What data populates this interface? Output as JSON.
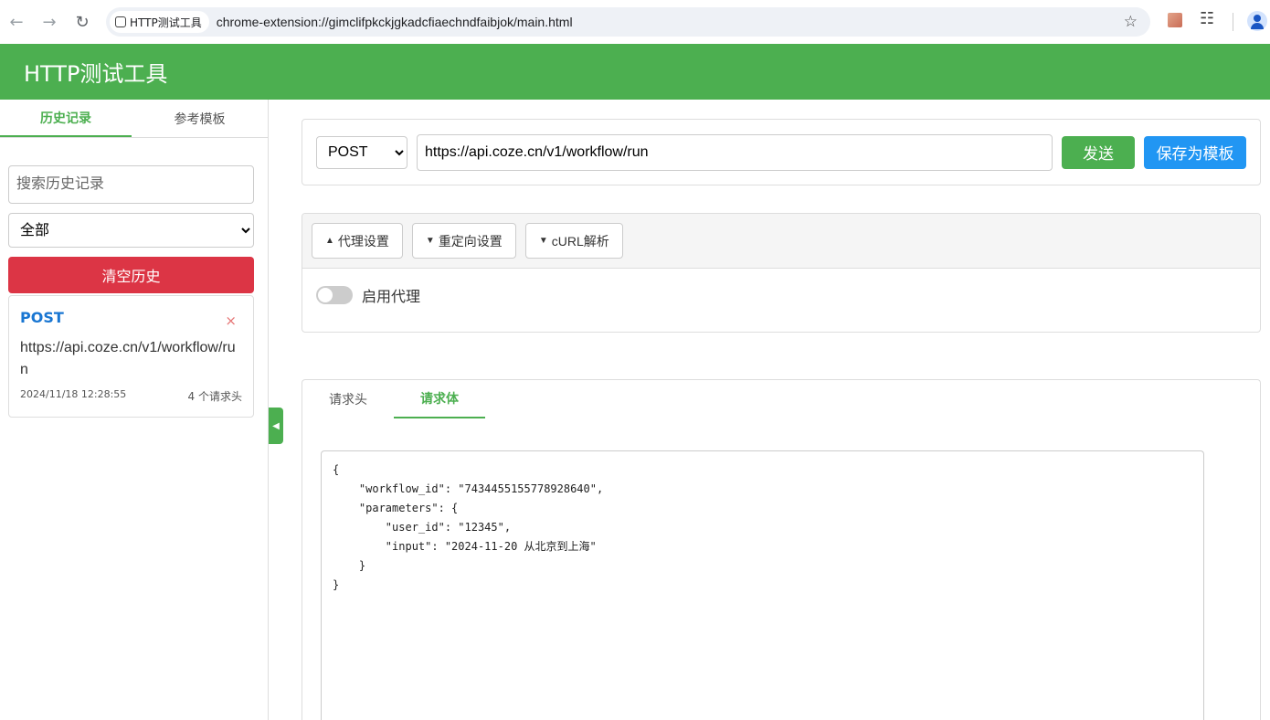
{
  "browser": {
    "tab_chip_label": "HTTP测试工具",
    "url": "chrome-extension://gimclifpkckjgkadcfiaechndfaibjok/main.html"
  },
  "app": {
    "title": "HTTP测试工具"
  },
  "sidebar": {
    "tabs": [
      {
        "label": "历史记录",
        "active": true
      },
      {
        "label": "参考模板",
        "active": false
      }
    ],
    "search_placeholder": "搜索历史记录",
    "filter_selected": "全部",
    "clear_button": "清空历史",
    "history": [
      {
        "method": "POST",
        "url": "https://api.coze.cn/v1/workflow/run",
        "time": "2024/11/18 12:28:55",
        "count": "4 个请求头",
        "close": "×"
      }
    ],
    "collapse_icon": "◀"
  },
  "request": {
    "method": "POST",
    "url": "https://api.coze.cn/v1/workflow/run",
    "send_label": "发送",
    "save_label": "保存为模板"
  },
  "settings": {
    "buttons": [
      {
        "arrow": "▲",
        "label": "代理设置"
      },
      {
        "arrow": "▼",
        "label": "重定向设置"
      },
      {
        "arrow": "▼",
        "label": "cURL解析"
      }
    ],
    "proxy_label": "启用代理",
    "proxy_enabled": false
  },
  "body_panel": {
    "tabs": [
      {
        "label": "请求头",
        "active": false
      },
      {
        "label": "请求体",
        "active": true
      }
    ],
    "content": "{\n    \"workflow_id\": \"7434455155778928640\",\n    \"parameters\": {\n        \"user_id\": \"12345\",\n        \"input\": \"2024-11-20 从北京到上海\"\n    }\n}"
  },
  "colors": {
    "brand_green": "#4caf50",
    "danger_red": "#dc3545",
    "primary_blue": "#2196f3",
    "method_blue": "#1976d2"
  }
}
